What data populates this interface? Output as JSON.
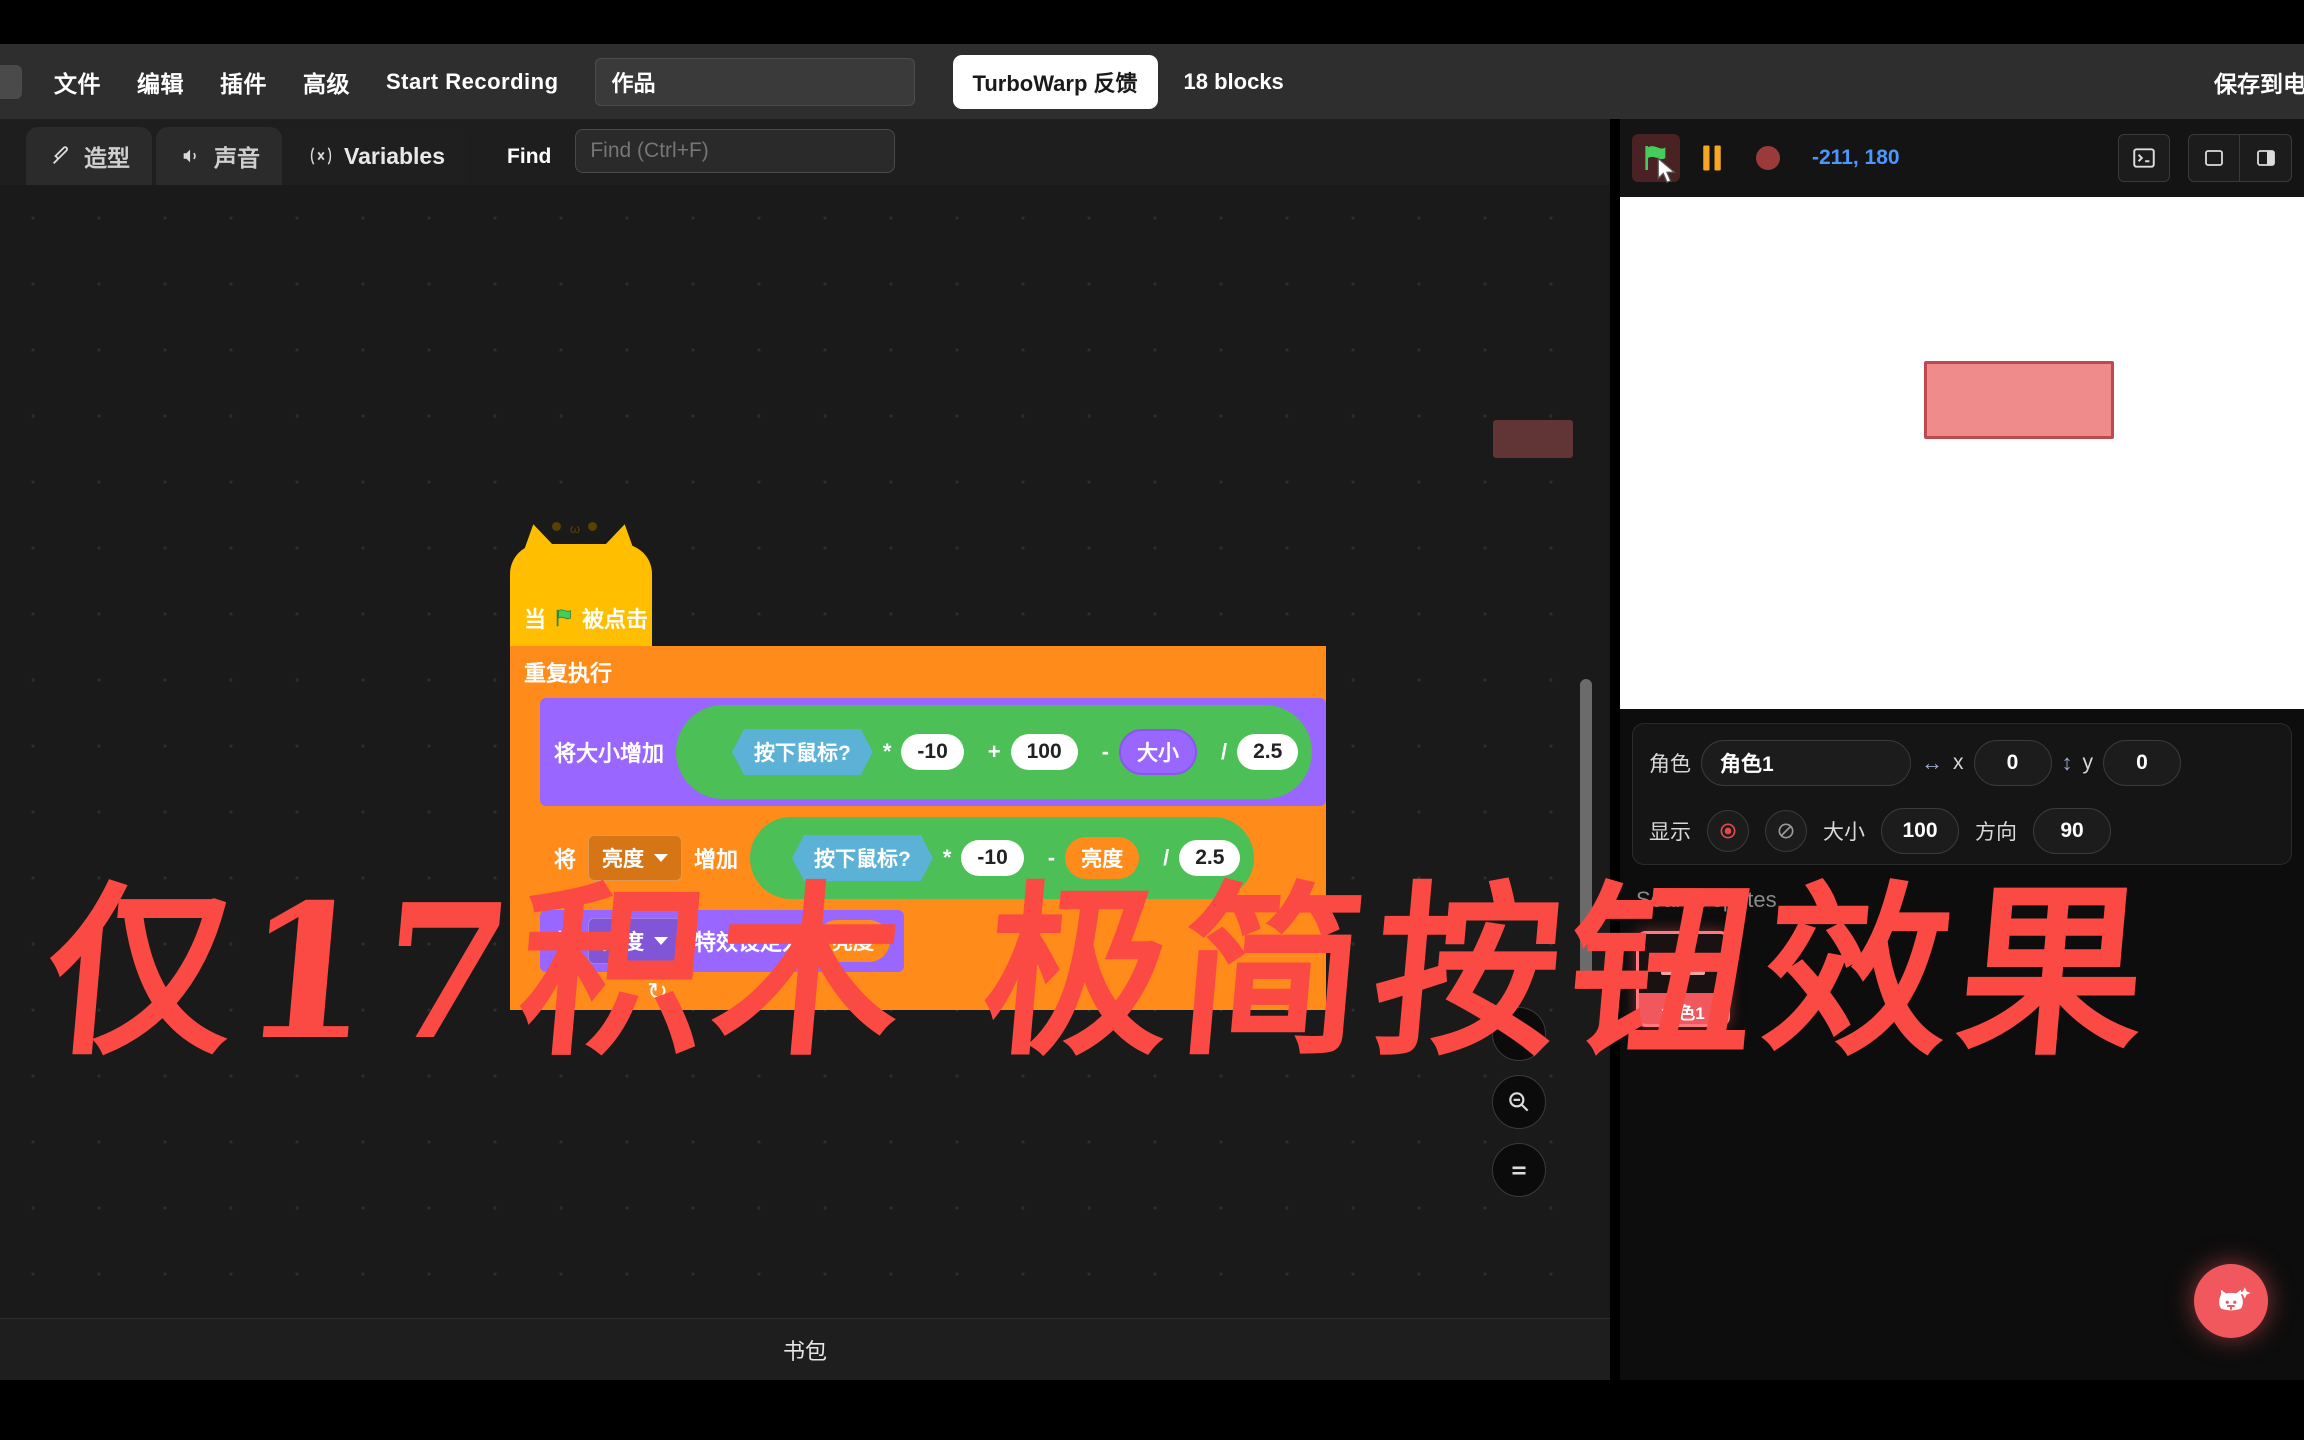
{
  "menubar": {
    "items": [
      {
        "label": "文件",
        "name": "menu-file"
      },
      {
        "label": "编辑",
        "name": "menu-edit"
      },
      {
        "label": "插件",
        "name": "menu-addons"
      },
      {
        "label": "高级",
        "name": "menu-advanced"
      },
      {
        "label": "Start Recording",
        "name": "menu-start-recording"
      }
    ],
    "project_title": "作品",
    "feedback_label": "TurboWarp 反馈",
    "block_count": "18 blocks",
    "save_label": "保存到电"
  },
  "tabbar": {
    "tabs": [
      {
        "label": "造型",
        "icon": "paintbrush-icon",
        "active": false
      },
      {
        "label": "声音",
        "icon": "speaker-icon",
        "active": false
      },
      {
        "label": "Variables",
        "icon": "variable-x-icon",
        "active": true
      }
    ],
    "find_label": "Find",
    "find_placeholder": "Find (Ctrl+F)",
    "find_value": ""
  },
  "script": {
    "hat": {
      "when": "当",
      "flag": "green-flag-icon",
      "clicked": "被点击"
    },
    "forever": "重复执行",
    "block1": {
      "label": "将大小增加",
      "sensing": "按下鼠标?",
      "op_mul": "*",
      "num1": "-10",
      "op_add": "+",
      "num2": "100",
      "op_sub": "-",
      "var": "大小",
      "op_div": "/",
      "num3": "2.5"
    },
    "block2": {
      "label_pre": "将",
      "dropdown": "亮度",
      "label_post": "增加",
      "sensing": "按下鼠标?",
      "op_mul": "*",
      "num1": "-10",
      "op_sub": "-",
      "var": "亮度",
      "op_div": "/",
      "num2": "2.5"
    },
    "block3": {
      "label_pre": "将",
      "dropdown": "亮度",
      "label_post": "特效设定为",
      "var": "亮度"
    }
  },
  "zoom_controls": {
    "zoom_in": "zoom-in-icon",
    "zoom_out": "zoom-out-icon",
    "zoom_reset": "zoom-reset-icon"
  },
  "backpack": {
    "label": "书包"
  },
  "stage": {
    "green_flag": "green-flag-icon",
    "pause": "pause-icon",
    "stop": "stop-icon",
    "coords": "-211, 180",
    "console_icon": "terminal-icon",
    "small_stage_icon": "small-stage-icon",
    "large_stage_icon": "large-stage-icon"
  },
  "sprite_info": {
    "sprite_label": "角色",
    "sprite_name": "角色1",
    "x_label": "x",
    "x_value": "0",
    "y_label": "y",
    "y_value": "0",
    "show_label": "显示",
    "size_label": "大小",
    "size_value": "100",
    "direction_label": "方向",
    "direction_value": "90"
  },
  "sprite_list": {
    "search_placeholder": "Search sprites",
    "items": [
      {
        "name": "角色1"
      }
    ]
  },
  "fab": {
    "icon": "cat-sparkle-icon"
  },
  "caption": {
    "text": "仅17积木 极简按钮效果"
  },
  "colors": {
    "accent_red": "#fb4a43",
    "motion_blue": "#4c97ff",
    "looks_purple": "#9966ff",
    "control_orange": "#ff8c1a",
    "operator_green": "#4cbf56",
    "sensing_blue": "#5cb1d6",
    "event_yellow": "#ffbf00"
  }
}
